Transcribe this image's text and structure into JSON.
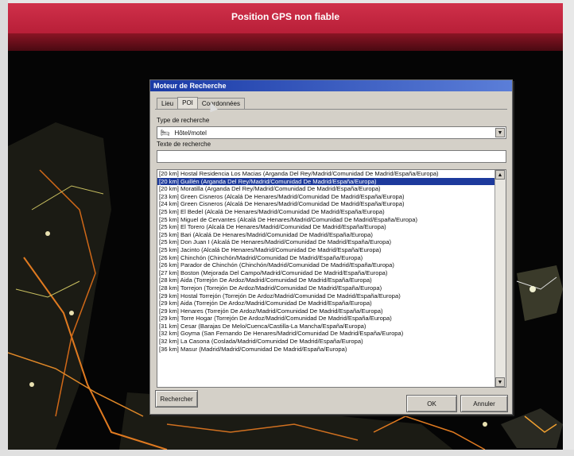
{
  "banner": {
    "message": "Position GPS non fiable"
  },
  "dialog": {
    "title": "Moteur de Recherche",
    "tabs": [
      {
        "label": "Lieu",
        "active": false
      },
      {
        "label": "POI",
        "active": true
      },
      {
        "label": "Coordonnées",
        "active": false
      }
    ],
    "search_type_label": "Type de recherche",
    "search_type_value": "Hôtel/motel",
    "search_text_label": "Texte de recherche",
    "search_text_value": "",
    "results": [
      "[20 km] Hostal Residencia Los Macias (Arganda Del Rey/Madrid/Comunidad De Madrid/España/Europa)",
      "[20 km] Guillén (Arganda Del Rey/Madrid/Comunidad De Madrid/España/Europa)",
      "[20 km] Moratilla (Arganda Del Rey/Madrid/Comunidad De Madrid/España/Europa)",
      "[23 km] Green Cisneros (Alcalá De Henares/Madrid/Comunidad De Madrid/España/Europa)",
      "[24 km] Green Cisneros (Alcalá De Henares/Madrid/Comunidad De Madrid/España/Europa)",
      "[25 km] El Bedel (Alcalá De Henares/Madrid/Comunidad De Madrid/España/Europa)",
      "[25 km] Miguel de Cervantes (Alcalá De Henares/Madrid/Comunidad De Madrid/España/Europa)",
      "[25 km] El Torero (Alcalá De Henares/Madrid/Comunidad De Madrid/España/Europa)",
      "[25 km] Bari (Alcalá De Henares/Madrid/Comunidad De Madrid/España/Europa)",
      "[25 km] Don Juan I (Alcalá De Henares/Madrid/Comunidad De Madrid/España/Europa)",
      "[25 km] Jacinto (Alcalá De Henares/Madrid/Comunidad De Madrid/España/Europa)",
      "[26 km] Chinchón (Chinchón/Madrid/Comunidad De Madrid/España/Europa)",
      "[26 km] Parador de Chinchón (Chinchón/Madrid/Comunidad De Madrid/España/Europa)",
      "[27 km] Boston (Mejorada Del Campo/Madrid/Comunidad De Madrid/España/Europa)",
      "[28 km] Aida (Torrejón De Ardoz/Madrid/Comunidad De Madrid/España/Europa)",
      "[28 km] Torrejon (Torrejón De Ardoz/Madrid/Comunidad De Madrid/España/Europa)",
      "[29 km] Hostal Torrejón (Torrejón De Ardoz/Madrid/Comunidad De Madrid/España/Europa)",
      "[29 km] Aida (Torrejón De Ardoz/Madrid/Comunidad De Madrid/España/Europa)",
      "[29 km] Henares (Torrejón De Ardoz/Madrid/Comunidad De Madrid/España/Europa)",
      "[29 km] Torre Hogar (Torrejón De Ardoz/Madrid/Comunidad De Madrid/España/Europa)",
      "[31 km] Cesar (Barajas De Melo/Cuenca/Castilla-La Mancha/España/Europa)",
      "[32 km] Goyma (San Fernando De Henares/Madrid/Comunidad De Madrid/España/Europa)",
      "[32 km] La Casona (Coslada/Madrid/Comunidad De Madrid/España/Europa)",
      "[36 km] Masur (Madrid/Madrid/Comunidad De Madrid/España/Europa)"
    ],
    "selected_index": 1,
    "buttons": {
      "search": "Rechercher",
      "ok": "OK",
      "cancel": "Annuler"
    }
  },
  "icons": {
    "hotel": "bed-icon",
    "dropdown": "chevron-down-icon",
    "scroll_up": "arrow-up-icon",
    "scroll_down": "arrow-down-icon"
  }
}
